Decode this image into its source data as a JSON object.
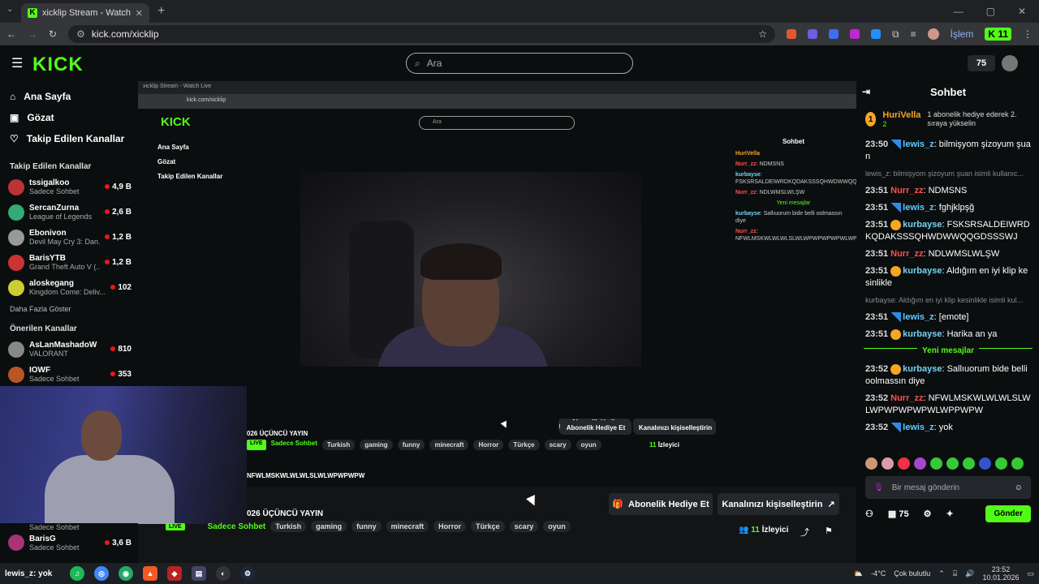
{
  "browser": {
    "tab_title": "xicklip Stream - Watch Live",
    "url": "kick.com/xicklip",
    "extension_label": "İşlem",
    "extension_badge": "11"
  },
  "header": {
    "logo": "KICK",
    "search_placeholder": "Ara",
    "coins": "75"
  },
  "sidebar": {
    "nav": [
      {
        "label": "Ana Sayfa",
        "icon": "home-icon"
      },
      {
        "label": "Gözat",
        "icon": "browse-icon"
      },
      {
        "label": "Takip Edilen Kanallar",
        "icon": "heart-icon"
      }
    ],
    "followed_title": "Takip Edilen Kanallar",
    "followed": [
      {
        "name": "tssigalkoo",
        "game": "Sadece Sohbet",
        "viewers": "4,9 B",
        "color": "#b33"
      },
      {
        "name": "SercanZurna",
        "game": "League of Legends",
        "viewers": "2,6 B",
        "color": "#3a7"
      },
      {
        "name": "Ebonivon",
        "game": "Devil May Cry 3: Dan...",
        "viewers": "1,2 B",
        "color": "#999"
      },
      {
        "name": "BarisYTB",
        "game": "Grand Theft Auto V (...",
        "viewers": "1,2 B",
        "color": "#c33"
      },
      {
        "name": "aloskegang",
        "game": "Kingdom Come: Deliv...",
        "viewers": "102",
        "color": "#cc3"
      }
    ],
    "more_label": "Daha Fazla Göster",
    "recommended_title": "Önerilen Kanallar",
    "recommended": [
      {
        "name": "AsLanMashadoW",
        "game": "VALORANT",
        "viewers": "810",
        "color": "#888"
      },
      {
        "name": "IOWF",
        "game": "Sadece Sohbet",
        "viewers": "353",
        "color": "#b52"
      }
    ],
    "bottom_channel": {
      "name": "BarisG",
      "game": "Sadece Sohbet",
      "viewers": "3,6 B",
      "color": "#a37"
    },
    "bottom_game_above": "Sadece Sohbet"
  },
  "stream": {
    "title_fragment": "026 ÜÇÜNCÜ YAYIN",
    "live_label": "LIVE",
    "category": "Sadece Sohbet",
    "tags": [
      "Turkish",
      "gaming",
      "funny",
      "minecraft",
      "Horror",
      "Türkçe",
      "scary",
      "oyun"
    ],
    "subscribe_gift_label": "Abonelik Hediye Et",
    "customize_label": "Kanalınızı kişiselleştirin",
    "viewers_count": "11",
    "viewers_label": "İzleyici",
    "overlay_text": "NFWLMSKWLWLWLSLWLWPWPWPW"
  },
  "chat": {
    "title": "Sohbet",
    "pinned_user": "HuriVella",
    "pinned_count": "2",
    "pinned_text": "1 abonelik hediye ederek 2. sıraya yükselin",
    "messages": [
      {
        "time": "23:50",
        "user": "lewis_z",
        "cls": "u-lewis",
        "badge": "l",
        "text": "bilmişyom şizoyum şuan"
      },
      {
        "time": "",
        "user": "",
        "cls": "",
        "badge": "",
        "text": "lewis_z: bilmişyom şizoyum şuan isimli kullanıc...",
        "reply": true
      },
      {
        "time": "23:51",
        "user": "Nurr_zz",
        "cls": "u-nurr",
        "badge": "",
        "text": "NDMSNS"
      },
      {
        "time": "23:51",
        "user": "lewis_z",
        "cls": "u-lewis",
        "badge": "l",
        "text": "fghjklpşğ"
      },
      {
        "time": "23:51",
        "user": "kurbayse",
        "cls": "u-kurb",
        "badge": "k",
        "text": "FSKSRSALDEIWRDKQDAKSSSQHWDWWQQGDSSSWJ"
      },
      {
        "time": "23:51",
        "user": "Nurr_zz",
        "cls": "u-nurr",
        "badge": "",
        "text": "NDLWMSLWLŞW"
      },
      {
        "time": "23:51",
        "user": "kurbayse",
        "cls": "u-kurb",
        "badge": "k",
        "text": "Aldığım en iyi klip kesinlikle"
      },
      {
        "time": "",
        "user": "",
        "cls": "",
        "badge": "",
        "text": "kurbayse: Aldığım en iyi klip kesinlikle isimli kul...",
        "reply": true
      },
      {
        "time": "23:51",
        "user": "lewis_z",
        "cls": "u-lewis",
        "badge": "l",
        "text": "[emote]"
      },
      {
        "time": "23:51",
        "user": "kurbayse",
        "cls": "u-kurb",
        "badge": "k",
        "text": "Harika an ya"
      }
    ],
    "new_messages_label": "Yeni mesajlar",
    "messages_after": [
      {
        "time": "23:52",
        "user": "kurbayse",
        "cls": "u-kurb",
        "badge": "k",
        "text": "Sallıuorum bide belli oolmassın diye"
      },
      {
        "time": "23:52",
        "user": "Nurr_zz",
        "cls": "u-nurr",
        "badge": "",
        "text": "NFWLMSKWLWLWLSLWLWPWPWPWPWLWPPWPW"
      },
      {
        "time": "23:52",
        "user": "lewis_z",
        "cls": "u-lewis",
        "badge": "l",
        "text": "yok"
      }
    ],
    "input_placeholder": "Bir mesaj gönderin",
    "coins": "75",
    "send_label": "Gönder"
  },
  "taskbar": {
    "weather_temp": "-4°C",
    "weather_text": "Çok bulutlu",
    "time": "23:52",
    "date": "10.01.2026",
    "leftmost_text": "lewis_z: yok"
  }
}
